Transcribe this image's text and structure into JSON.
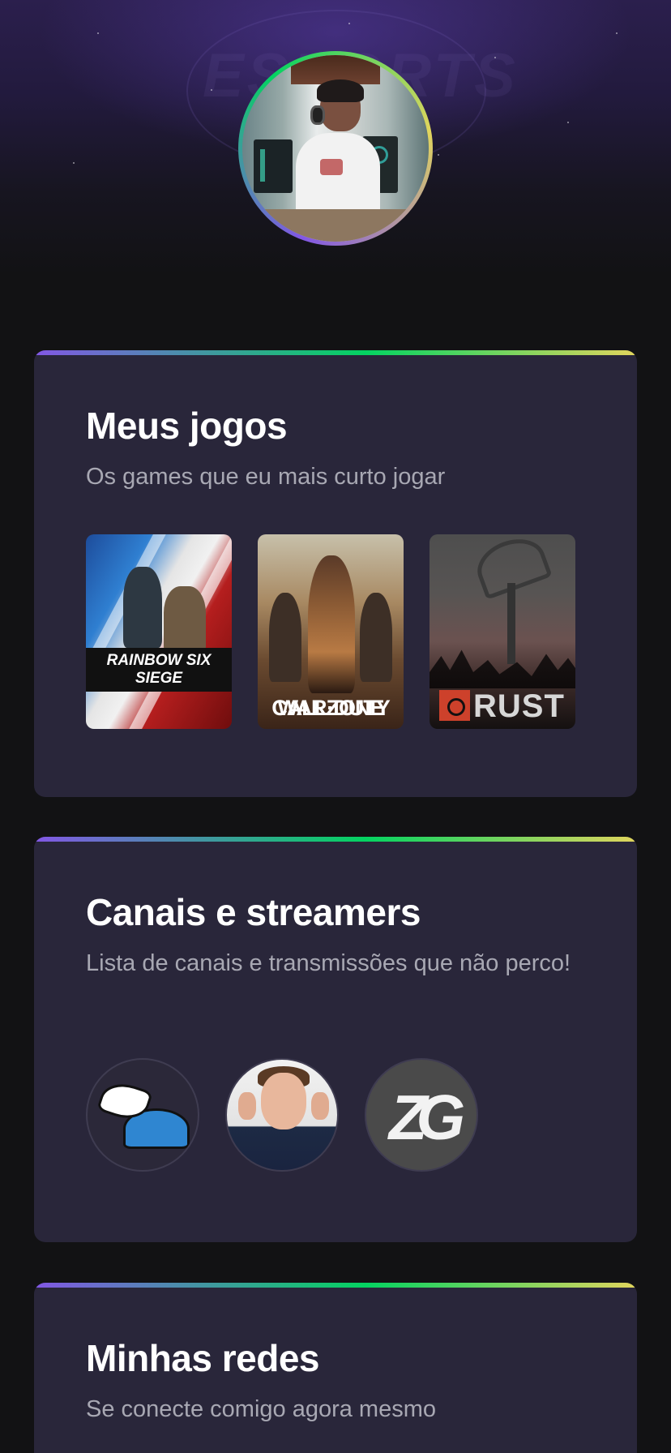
{
  "profile": {
    "avatar_alt": "Foto de perfil",
    "header_watermark": "ESPORTS"
  },
  "sections": {
    "games": {
      "title": "Meus jogos",
      "subtitle": "Os games que eu mais curto jogar",
      "items": [
        {
          "name": "Rainbow Six Siege",
          "cover_text": "RAINBOW SIX SIEGE"
        },
        {
          "name": "Call of Duty Warzone",
          "cover_text_top": "CALL·DUTY",
          "cover_text": "WARZONE"
        },
        {
          "name": "Rust",
          "cover_text": "RUST"
        }
      ]
    },
    "channels": {
      "title": "Canais e streamers",
      "subtitle": "Lista de canais e transmissões que não perco!",
      "items": [
        {
          "name": "canal-1",
          "icon": "winged-cap-icon"
        },
        {
          "name": "canal-2",
          "icon": "streamer-photo"
        },
        {
          "name": "canal-3",
          "cover_text": "ZG"
        }
      ]
    },
    "socials": {
      "title": "Minhas redes",
      "subtitle": "Se conecte comigo agora mesmo"
    }
  },
  "colors": {
    "background": "#121214",
    "card": "#29263a",
    "gradient": [
      "#8257e5",
      "#04d361",
      "#e1d55d"
    ],
    "subtitle": "#a8a8b3"
  }
}
